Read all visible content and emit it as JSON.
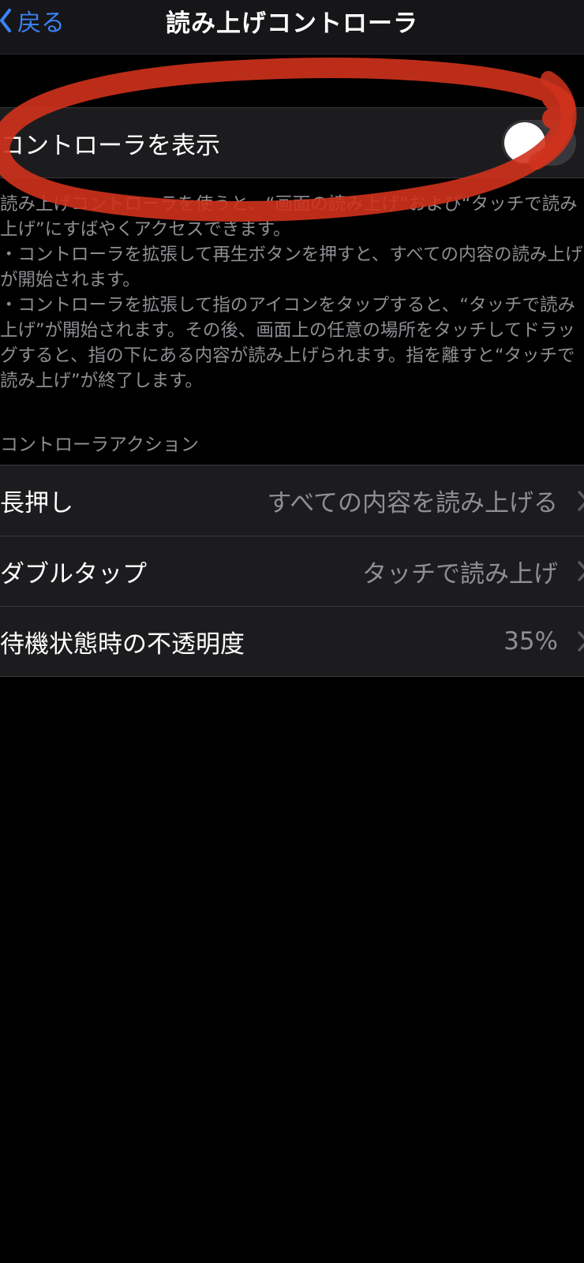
{
  "nav": {
    "back_label": "戻る",
    "title": "読み上げコントローラ"
  },
  "show_controller": {
    "label": "コントローラを表示",
    "toggle_on": false
  },
  "description": [
    "読み上げコントローラを使うと、“画面の読み上げ”および“タッチで読み上げ”にすばやくアクセスできます。",
    "・コントローラを拡張して再生ボタンを押すと、すべての内容の読み上げが開始されます。",
    "・コントローラを拡張して指のアイコンをタップすると、“タッチで読み上げ”が開始されます。その後、画面上の任意の場所をタッチしてドラッグすると、指の下にある内容が読み上げられます。指を離すと“タッチで読み上げ”が終了します。"
  ],
  "actions_section": {
    "header": "コントローラアクション",
    "rows": [
      {
        "label": "長押し",
        "value": "すべての内容を読み上げる"
      },
      {
        "label": "ダブルタップ",
        "value": "タッチで読み上げ"
      },
      {
        "label": "待機状態時の不透明度",
        "value": "35%"
      }
    ]
  },
  "colors": {
    "accent": "#3a82f7",
    "background": "#000000",
    "cell": "#1c1c1e",
    "secondary_text": "#8e8e93",
    "annotation": "#d0321c"
  },
  "icons": {
    "back": "chevron-left-icon",
    "disclosure": "chevron-right-icon"
  }
}
